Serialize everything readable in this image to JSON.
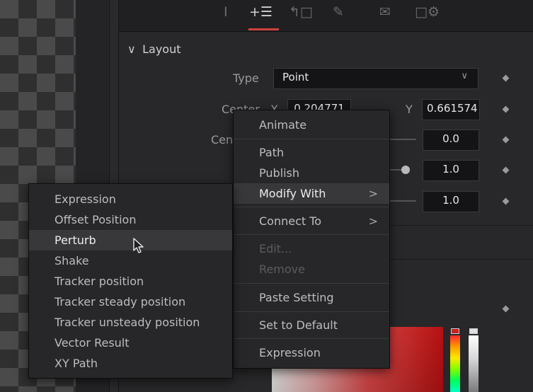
{
  "inspector": {
    "tabs": [
      {
        "icon": "tools-icon",
        "glyph": "Ⅰ"
      },
      {
        "icon": "modifiers-icon",
        "glyph": "+☰"
      },
      {
        "icon": "keyframe-icon",
        "glyph": "↰□"
      },
      {
        "icon": "paint-icon",
        "glyph": "✎"
      },
      {
        "icon": "envelope-icon",
        "glyph": "✉"
      },
      {
        "icon": "settings-icon",
        "glyph": "□⚙"
      }
    ],
    "layout_section": {
      "chevron": "∨",
      "title": "Layout"
    },
    "type_label": "Type",
    "type_value": "Point",
    "center_label": "Center",
    "x_label": "X",
    "x_value": "0.204771",
    "y_label": "Y",
    "y_value": "0.661574",
    "row3_label": "Center Z",
    "row3_value": "0.0",
    "row4_value": "1.0",
    "row5_value": "1.0",
    "accent_color": "#d0413f"
  },
  "context_menu": {
    "items": [
      {
        "label": "Animate",
        "enabled": true
      },
      {
        "label": "Path",
        "enabled": true
      },
      {
        "label": "Publish",
        "enabled": true
      },
      {
        "label": "Modify With",
        "enabled": true,
        "submenu": true,
        "highlighted": true
      },
      {
        "label": "Connect To",
        "enabled": true,
        "submenu": true
      },
      {
        "label": "Edit...",
        "enabled": false
      },
      {
        "label": "Remove",
        "enabled": false
      },
      {
        "label": "Paste Setting",
        "enabled": true
      },
      {
        "label": "Set to Default",
        "enabled": true
      },
      {
        "label": "Expression",
        "enabled": true
      }
    ],
    "submenu_arrow": ">"
  },
  "modify_submenu": {
    "items": [
      {
        "label": "Expression"
      },
      {
        "label": "Offset Position"
      },
      {
        "label": "Perturb",
        "highlighted": true
      },
      {
        "label": "Shake"
      },
      {
        "label": "Tracker position"
      },
      {
        "label": "Tracker steady position"
      },
      {
        "label": "Tracker unsteady position"
      },
      {
        "label": "Vector Result"
      },
      {
        "label": "XY Path"
      }
    ]
  }
}
